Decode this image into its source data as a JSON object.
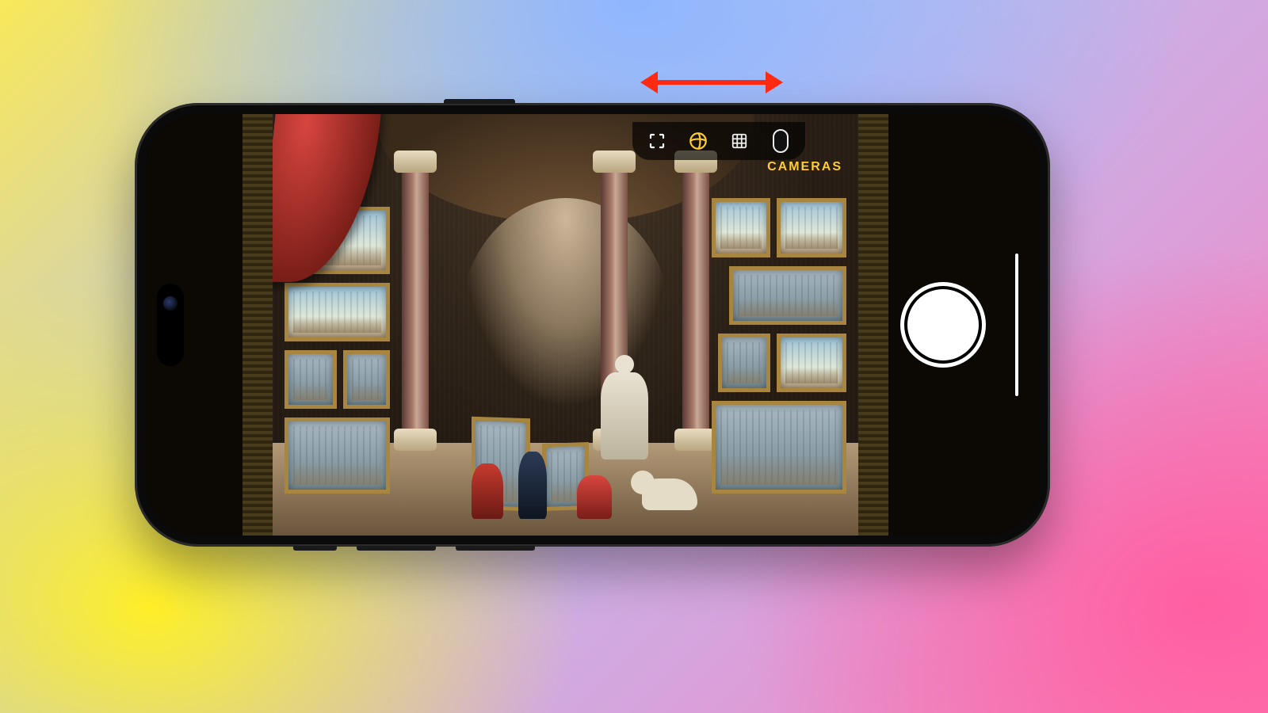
{
  "label": "CAMERAS",
  "icons": {
    "focus": "focus-frame-icon",
    "styles": "photographic-styles-icon",
    "grid": "grid-icon",
    "rotation": "rotation-lock-pill"
  },
  "colors": {
    "accent": "#ffcc33",
    "annotation": "#ff2a12"
  }
}
